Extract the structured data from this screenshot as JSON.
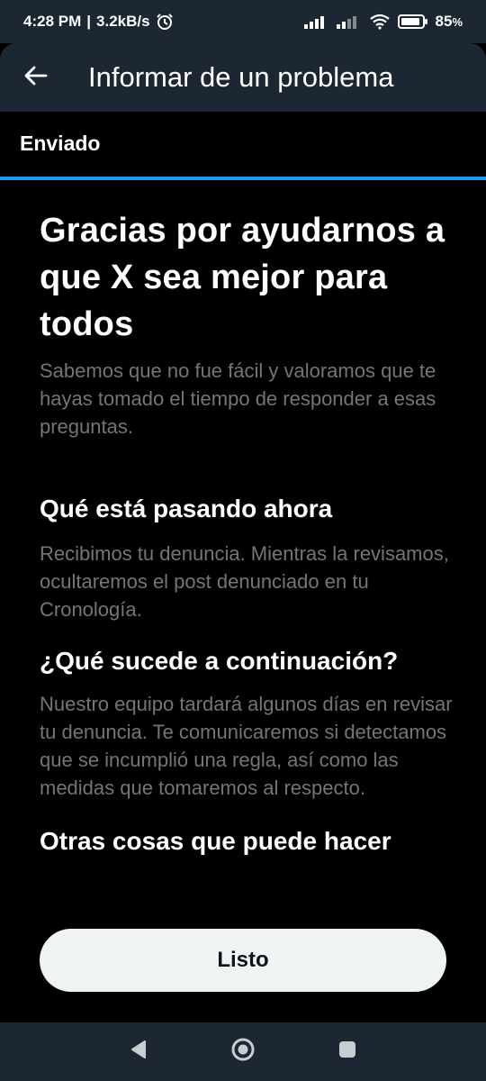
{
  "status_bar": {
    "time": "4:28 PM",
    "separator": "|",
    "speed": "3.2kB/s",
    "battery": "85",
    "battery_unit": "%",
    "alarm_icon": "alarm-clock-icon",
    "signal_icon": "cell-signal-icon",
    "wifi_icon": "wifi-icon",
    "battery_icon": "battery-icon"
  },
  "header": {
    "title": "Informar de un problema",
    "back_icon": "arrow-left-icon"
  },
  "progress": {
    "step_label": "Enviado",
    "fraction": 1.0,
    "color": "#1d9bf0"
  },
  "content": {
    "headline": "Gracias por ayudarnos a que X sea mejor para todos",
    "intro": "Sabemos que no fue fácil y valoramos que te hayas tomado el tiempo de responder a esas preguntas.",
    "sections": [
      {
        "title": "Qué está pasando ahora",
        "body": "Recibimos tu denuncia. Mientras la revisamos, ocultaremos el post denunciado en tu Cronología."
      },
      {
        "title": "¿Qué sucede a continuación?",
        "body": "Nuestro equipo tardará algunos días en revisar tu denuncia. Te comunicaremos si detectamos que se incumplió una regla, así como las medidas que tomaremos al respecto."
      },
      {
        "title": "Otras cosas que puede hacer"
      }
    ]
  },
  "actions": {
    "done_label": "Listo"
  },
  "nav_bar": {
    "back_icon": "triangle-back-icon",
    "home_icon": "circle-home-icon",
    "recents_icon": "square-recents-icon"
  },
  "colors": {
    "background": "#000000",
    "bar": "#1c2733",
    "text_secondary": "#71767b",
    "accent": "#1d9bf0",
    "button_bg": "#eff3f4"
  }
}
